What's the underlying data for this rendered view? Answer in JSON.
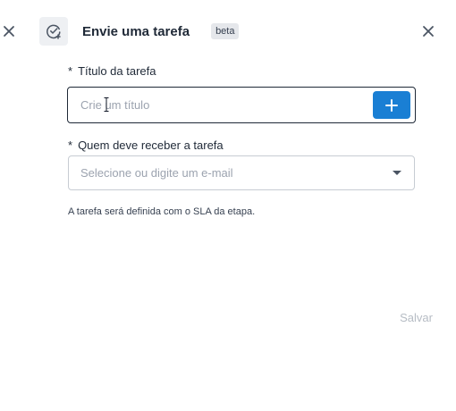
{
  "header": {
    "title": "Envie uma tarefa",
    "badge": "beta",
    "icons": {
      "left_close": "close-icon",
      "task": "task-check-add-icon",
      "right_close": "close-icon"
    }
  },
  "form": {
    "title_field": {
      "required_mark": "*",
      "label": "Título da tarefa",
      "placeholder": "Crie um título",
      "value": "",
      "add_button_icon": "plus-icon"
    },
    "recipient_field": {
      "required_mark": "*",
      "label": "Quem deve receber a tarefa",
      "placeholder": "Selecione ou digite um e-mail",
      "caret_icon": "caret-down-icon"
    },
    "helper_text": "A tarefa será definida com o SLA da etapa."
  },
  "footer": {
    "save_label": "Salvar",
    "save_enabled": false
  },
  "colors": {
    "accent": "#1a7fd4",
    "text": "#1f2937",
    "placeholder": "#9ca3af",
    "disabled": "#b6bcc4",
    "icon_box": "#eef0f3",
    "badge_bg": "#e5e7eb"
  }
}
